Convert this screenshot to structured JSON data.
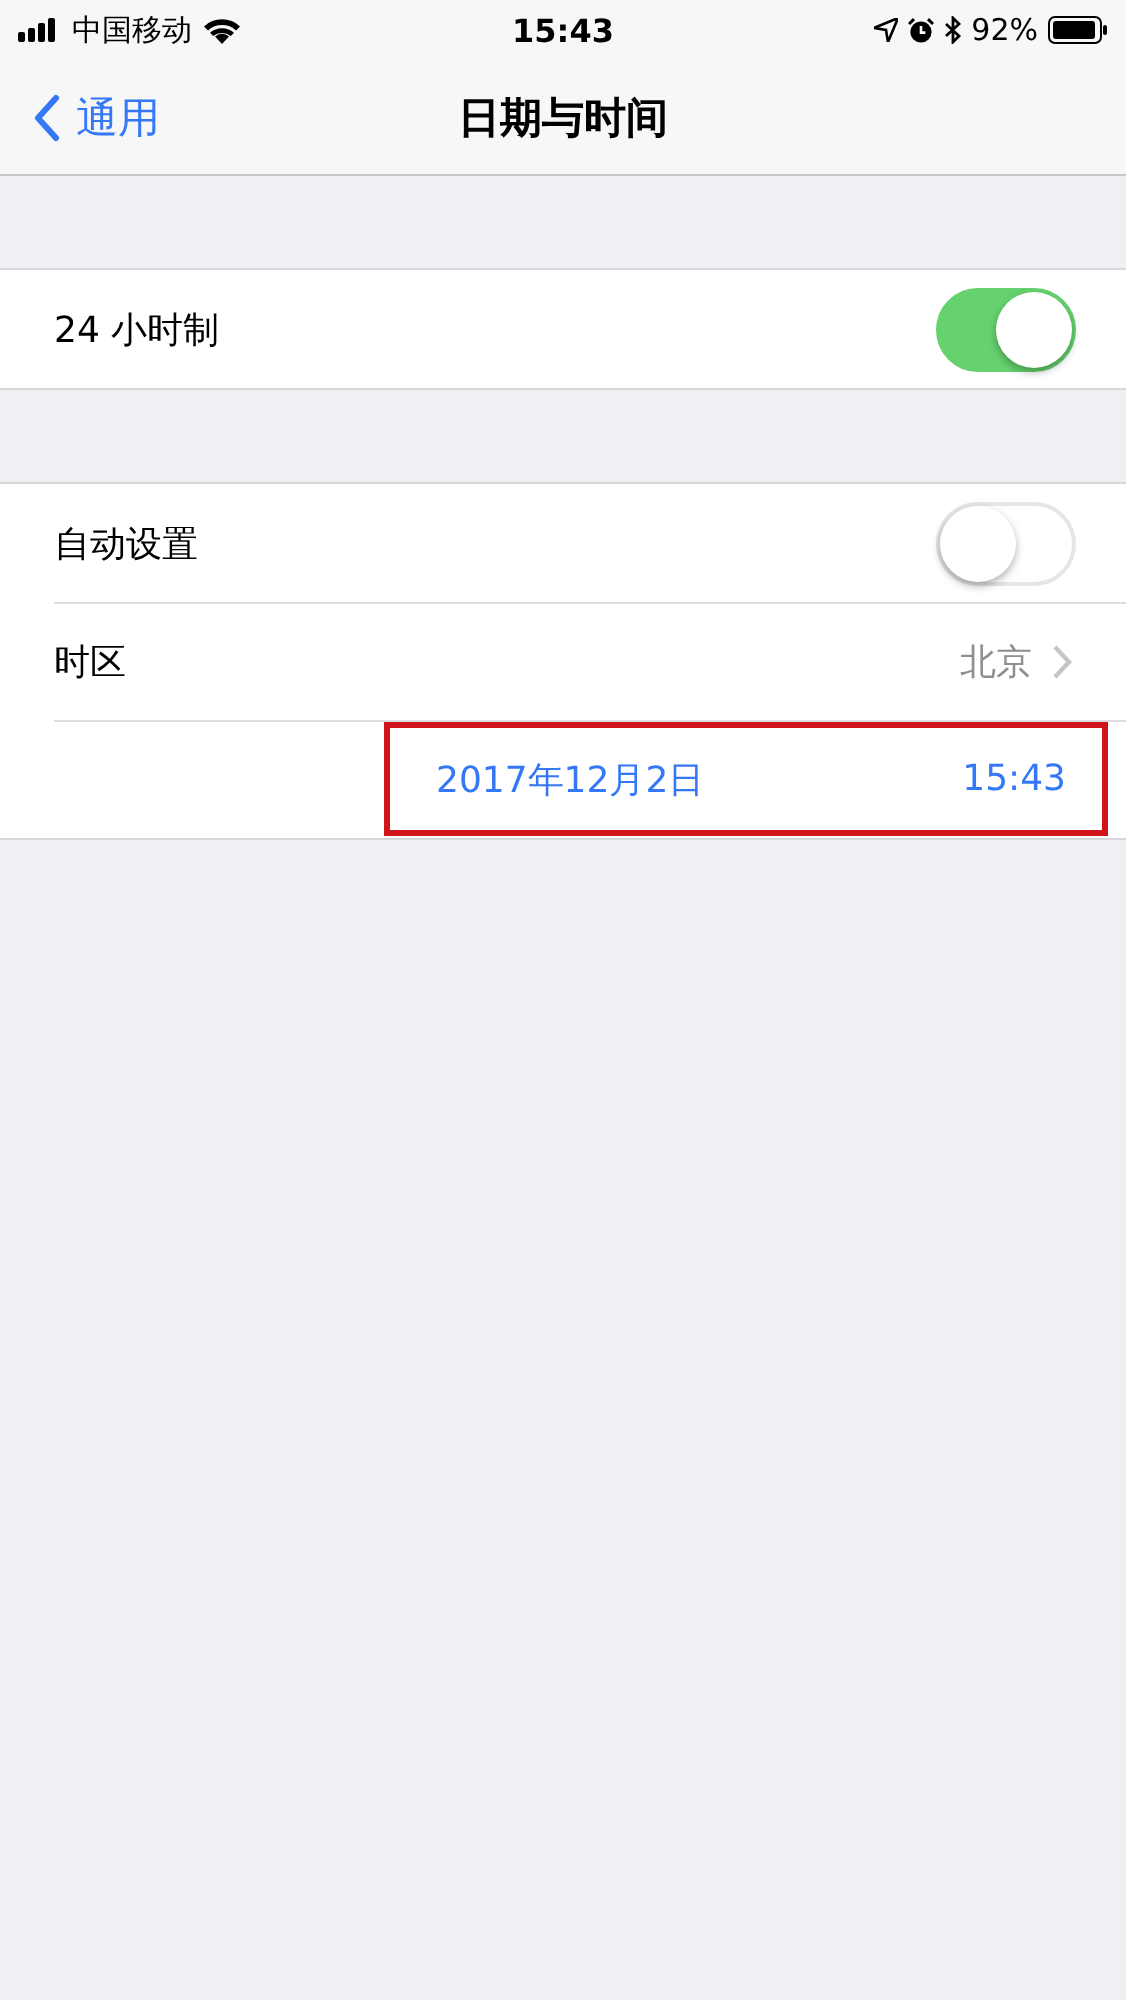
{
  "status_bar": {
    "carrier": "中国移动",
    "time": "15:43",
    "battery": "92%"
  },
  "nav": {
    "back": "通用",
    "title": "日期与时间"
  },
  "groups": [
    {
      "rows": [
        {
          "kind": "toggle",
          "label": "24 小时制",
          "on": true
        }
      ]
    },
    {
      "rows": [
        {
          "kind": "toggle",
          "label": "自动设置",
          "on": false
        },
        {
          "kind": "link",
          "label": "时区",
          "value": "北京"
        },
        {
          "kind": "datetime",
          "date": "2017年12月2日",
          "time": "15:43",
          "highlighted": true
        }
      ]
    }
  ]
}
